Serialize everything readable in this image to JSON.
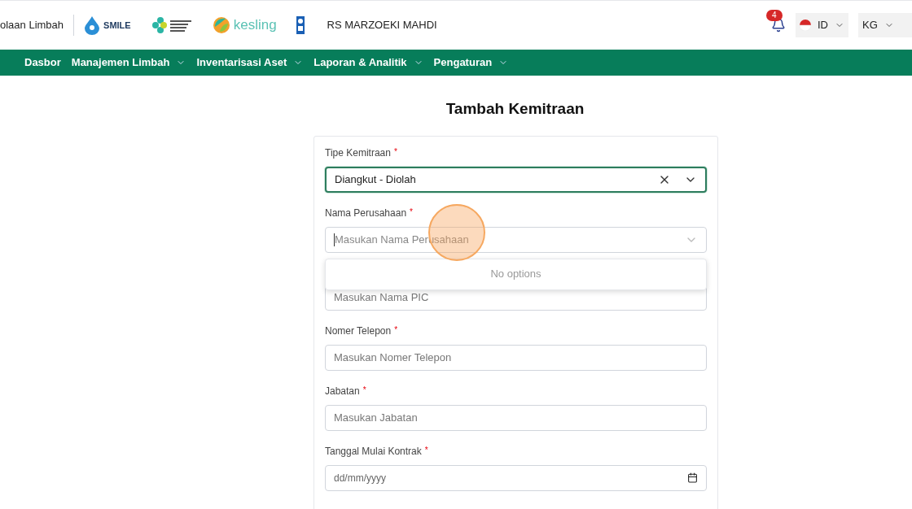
{
  "header": {
    "app_name": "olaan Limbah",
    "logos": [
      {
        "kind": "smile",
        "text": "SMILE"
      },
      {
        "kind": "kemenkes"
      },
      {
        "kind": "kesling",
        "text": "kesling"
      },
      {
        "kind": "undp"
      }
    ],
    "hospital": "RS MARZOEKI MAHDI",
    "notifications": {
      "count": "4"
    },
    "language": {
      "code": "ID"
    },
    "user": {
      "initials": "KG"
    }
  },
  "nav": [
    {
      "label": "Dasbor",
      "dropdown": false
    },
    {
      "label": "Manajemen Limbah",
      "dropdown": true
    },
    {
      "label": "Inventarisasi Aset",
      "dropdown": true
    },
    {
      "label": "Laporan & Analitik",
      "dropdown": true
    },
    {
      "label": "Pengaturan",
      "dropdown": true
    }
  ],
  "form": {
    "title": "Tambah Kemitraan",
    "fields": [
      {
        "kind": "select",
        "label": "Tipe Kemitraan",
        "required_mark": "*",
        "value": "Diangkut - Diolah",
        "focused": true,
        "clearable": true
      },
      {
        "kind": "combo",
        "label": "Nama Perusahaan",
        "required_mark": "*",
        "placeholder": "Masukan Nama Perusahaan",
        "menu": "No options"
      },
      {
        "kind": "text",
        "placeholder": "Masukan Nama PIC"
      },
      {
        "kind": "text",
        "label": "Nomer Telepon",
        "required_mark": "*",
        "placeholder": "Masukan Nomer Telepon"
      },
      {
        "kind": "text",
        "label": "Jabatan",
        "required_mark": "*",
        "placeholder": "Masukan Jabatan"
      },
      {
        "kind": "date",
        "label": "Tanggal Mulai Kontrak",
        "required_mark": "*",
        "placeholder": "dd/mm/yyyy"
      }
    ]
  }
}
